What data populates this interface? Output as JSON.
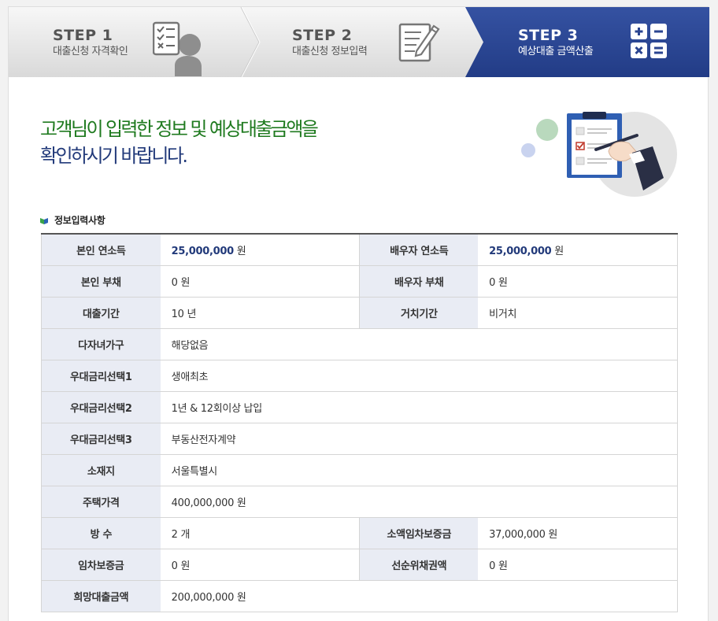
{
  "steps": [
    {
      "num": "STEP 1",
      "label": "대출신청 자격확인",
      "icon": "checklist-person-icon",
      "active": false
    },
    {
      "num": "STEP 2",
      "label": "대출신청 정보입력",
      "icon": "document-pen-icon",
      "active": false
    },
    {
      "num": "STEP 3",
      "label": "예상대출 금액산출",
      "icon": "calculator-icon",
      "active": true
    }
  ],
  "headline": {
    "line1": "고객님이 입력한 정보 및 예상대출금액을",
    "line2": "확인하시기 바랍니다."
  },
  "section": {
    "title": "정보입력사항"
  },
  "rows": [
    {
      "l1": "본인 연소득",
      "v1": "25,000,000",
      "u1": " 원",
      "l2": "배우자 연소득",
      "v2": "25,000,000",
      "u2": " 원"
    },
    {
      "l1": "본인 부채",
      "v1": "0 원",
      "l2": "배우자 부채",
      "v2": "0 원"
    },
    {
      "l1": "대출기간",
      "v1": "10 년",
      "l2": "거치기간",
      "v2": "비거치"
    },
    {
      "l1": "다자녀가구",
      "v1": "해당없음"
    },
    {
      "l1": "우대금리선택1",
      "v1": "생애최초"
    },
    {
      "l1": "우대금리선택2",
      "v1": "1년 & 12회이상 납입"
    },
    {
      "l1": "우대금리선택3",
      "v1": "부동산전자계약"
    },
    {
      "l1": "소재지",
      "v1": "서울특별시"
    },
    {
      "l1": "주택가격",
      "v1": "400,000,000 원"
    },
    {
      "l1": "방 수",
      "v1": "2 개",
      "l2": "소액임차보증금",
      "v2": "37,000,000 원"
    },
    {
      "l1": "임차보증금",
      "v1": "0 원",
      "l2": "선순위채권액",
      "v2": "0 원"
    },
    {
      "l1": "희망대출금액",
      "v1": "200,000,000 원"
    }
  ],
  "colors": {
    "active_step": "#2b4590",
    "header_cell": "#e9ecf4",
    "headline_green": "#1f7a1f",
    "headline_navy": "#223a7a"
  }
}
